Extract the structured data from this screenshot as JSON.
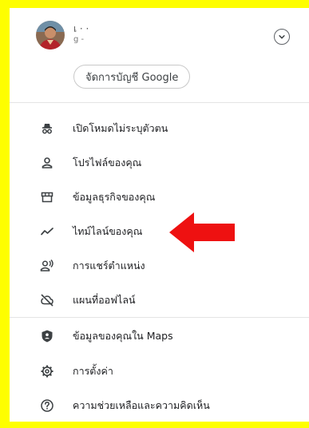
{
  "account": {
    "name": "เ  ·    ·",
    "email": "g    -",
    "manage_label": "จัดการบัญชี Google"
  },
  "menu": {
    "items": [
      {
        "label": "เปิดโหมดไม่ระบุตัวตน",
        "icon": "incognito-icon"
      },
      {
        "label": "โปรไฟล์ของคุณ",
        "icon": "person-icon"
      },
      {
        "label": "ข้อมูลธุรกิจของคุณ",
        "icon": "store-icon"
      },
      {
        "label": "ไทม์ไลน์ของคุณ",
        "icon": "timeline-icon"
      },
      {
        "label": "การแชร์ตำแหน่ง",
        "icon": "location-sharing-icon"
      },
      {
        "label": "แผนที่ออฟไลน์",
        "icon": "offline-off-icon"
      },
      {
        "label": "ข้อมูลของคุณใน Maps",
        "icon": "shield-icon"
      },
      {
        "label": "การตั้งค่า",
        "icon": "gear-icon"
      },
      {
        "label": "ความช่วยเหลือและความคิดเห็น",
        "icon": "help-icon"
      }
    ]
  },
  "colors": {
    "highlight_border": "#fefe00",
    "arrow": "#ee1111",
    "text": "#202124",
    "icon": "#3c4043"
  }
}
